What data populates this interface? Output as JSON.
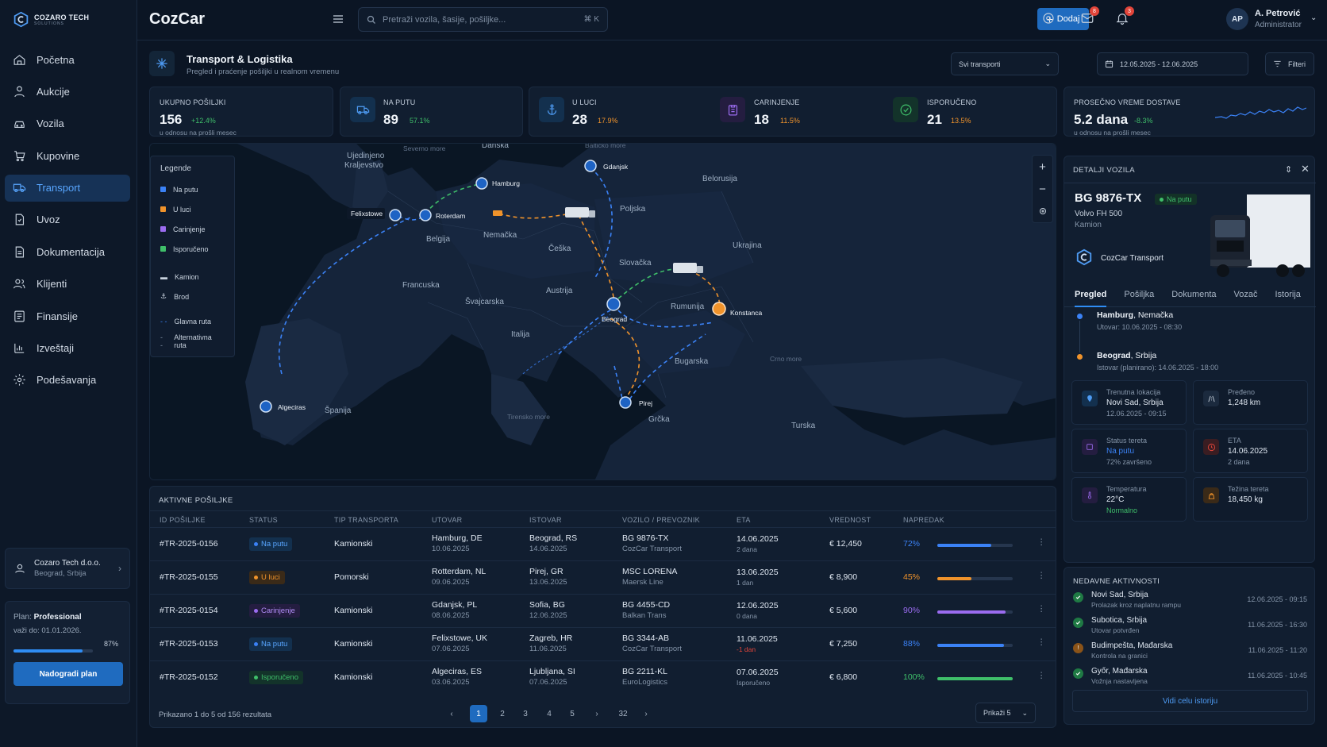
{
  "brand": {
    "name": "COZARO TECH",
    "sub": "SOLUTIONS"
  },
  "app_title": "CozCar",
  "nav": [
    {
      "label": "Početna",
      "icon": "home-icon"
    },
    {
      "label": "Aukcije",
      "icon": "gavel-icon"
    },
    {
      "label": "Vozila",
      "icon": "car-icon"
    },
    {
      "label": "Kupovine",
      "icon": "cart-icon"
    },
    {
      "label": "Transport",
      "icon": "truck-icon",
      "active": true
    },
    {
      "label": "Uvoz",
      "icon": "import-icon"
    },
    {
      "label": "Dokumentacija",
      "icon": "document-icon"
    },
    {
      "label": "Klijenti",
      "icon": "users-icon"
    },
    {
      "label": "Finansije",
      "icon": "finance-icon"
    },
    {
      "label": "Izveštaji",
      "icon": "report-icon"
    },
    {
      "label": "Podešavanja",
      "icon": "gear-icon"
    }
  ],
  "company": {
    "name": "Cozaro Tech d.o.o.",
    "city": "Beograd, Srbija"
  },
  "plan": {
    "label": "Plan:",
    "name": "Professional",
    "valid": "važi do: 01.01.2026.",
    "usage": 0.87,
    "usage_text": "87%",
    "button": "Nadogradi plan"
  },
  "search": {
    "placeholder": "Pretraži vozila, šasije, pošiljke...",
    "shortcut": "⌘ K"
  },
  "add_button": "Dodaj",
  "notifications": {
    "mail": "8",
    "bell": "3"
  },
  "user": {
    "initials": "AP",
    "name": "A. Petrović",
    "role": "Administrator"
  },
  "page": {
    "title": "Transport & Logistika",
    "subtitle": "Pregled i praćenje pošiljki u realnom vremenu"
  },
  "filters": {
    "transport": "Svi transporti",
    "dates": "12.05.2025 - 12.06.2025",
    "filter": "Filteri"
  },
  "kpis": [
    {
      "label": "UKUPNO POŠILJKI",
      "value": "156",
      "pct": "+12.4%",
      "note": "u odnosu na prošli mesec",
      "color": "#3fbf6a"
    },
    {
      "label": "NA PUTU",
      "value": "89",
      "pct": "57.1%",
      "color": "#3fbf6a"
    },
    {
      "label": "U LUCI",
      "value": "28",
      "pct": "17.9%",
      "color": "#f0932b"
    },
    {
      "label": "CARINJENJE",
      "value": "18",
      "pct": "11.5%",
      "color": "#f0932b"
    },
    {
      "label": "ISPORUČENO",
      "value": "21",
      "pct": "13.5%",
      "color": "#f0932b"
    },
    {
      "label": "PROSEČNO VREME DOSTAVE",
      "value": "5.2 dana",
      "pct": "-8.3%",
      "note": "u odnosu na prošli mesec",
      "color": "#3fbf6a"
    }
  ],
  "legend": {
    "title": "Legende",
    "items": [
      "Na putu",
      "U luci",
      "Carinjenje",
      "Isporučeno",
      "Kamion",
      "Brod",
      "Glavna ruta",
      "Alternativna ruta"
    ],
    "colors": [
      "#3b82f6",
      "#f0932b",
      "#9b6cf0",
      "#3fbf6a"
    ]
  },
  "map": {
    "countries": [
      "Ujedinjeno Kraljevstvo",
      "Danska",
      "Belorusija",
      "Poljska",
      "Nemačka",
      "Belgija",
      "Češka",
      "Slovačka",
      "Ukrajina",
      "Francuska",
      "Švajcarska",
      "Austrija",
      "Rumunija",
      "Italija",
      "Bugarska",
      "Španija",
      "Grčka",
      "Turska"
    ],
    "seas": [
      "Severno more",
      "Baltičko more",
      "Crno more",
      "Tirensko more"
    ],
    "ports": [
      "Felixstowe",
      "Roterdam",
      "Hamburg",
      "Gdanjsk",
      "Beograd",
      "Konstanca",
      "Pirej",
      "Algeciras"
    ]
  },
  "detail": {
    "header": "DETALJI VOZILA",
    "plate": "BG 9876-TX",
    "status": "Na putu",
    "model": "Volvo FH 500",
    "type": "Kamion",
    "carrier": "CozCar Transport",
    "tabs": [
      "Pregled",
      "Pošiljka",
      "Dokumenta",
      "Vozač",
      "Istorija"
    ],
    "from": {
      "city": "Hamburg",
      "country": ", Nemačka",
      "time": "Utovar: 10.06.2025 - 08:30"
    },
    "to": {
      "city": "Beograd",
      "country": ", Srbija",
      "time": "Istovar (planirano): 14.06.2025 - 18:00"
    },
    "tiles": [
      {
        "l": "Trenutna lokacija",
        "v": "Novi Sad, Srbija",
        "s": "12.06.2025 - 09:15"
      },
      {
        "l": "Pređeno",
        "v": "1,248 km",
        "s": ""
      },
      {
        "l": "Status tereta",
        "v": "Na putu",
        "s": "72% završeno"
      },
      {
        "l": "ETA",
        "v": "14.06.2025",
        "s": "2 dana"
      },
      {
        "l": "Temperatura",
        "v": "22°C",
        "s": "Normalno"
      },
      {
        "l": "Težina tereta",
        "v": "18,450 kg",
        "s": ""
      }
    ]
  },
  "activities": {
    "title": "NEDAVNE AKTIVNOSTI",
    "items": [
      {
        "name": "Novi Sad, Srbija",
        "desc": "Prolazak kroz naplatnu rampu",
        "time": "12.06.2025 - 09:15"
      },
      {
        "name": "Subotica, Srbija",
        "desc": "Utovar potvrđen",
        "time": "11.06.2025 - 16:30"
      },
      {
        "name": "Budimpešta, Mađarska",
        "desc": "Kontrola na granici",
        "time": "11.06.2025 - 11:20"
      },
      {
        "name": "Győr, Mađarska",
        "desc": "Vožnja nastavljena",
        "time": "11.06.2025 - 10:45"
      }
    ],
    "button": "Vidi celu istoriju"
  },
  "table": {
    "title": "AKTIVNE POŠILJKE",
    "headers": [
      "ID POŠILJKE",
      "STATUS",
      "TIP TRANSPORTA",
      "UTOVAR",
      "ISTOVAR",
      "VOZILO / PREVOZNIK",
      "ETA",
      "VREDNOST",
      "NAPREDAK"
    ],
    "rows": [
      {
        "id": "#TR-2025-0156",
        "status": "Na putu",
        "type": "Kamionski",
        "from": "Hamburg, DE",
        "from_d": "10.06.2025",
        "to": "Beograd, RS",
        "to_d": "14.06.2025",
        "veh": "BG 9876-TX",
        "car": "CozCar Transport",
        "eta": "14.06.2025",
        "eta_s": "2 dana",
        "val": "€ 12,450",
        "prog": 0.72,
        "prog_t": "72%"
      },
      {
        "id": "#TR-2025-0155",
        "status": "U luci",
        "type": "Pomorski",
        "from": "Rotterdam, NL",
        "from_d": "09.06.2025",
        "to": "Pirej, GR",
        "to_d": "13.06.2025",
        "veh": "MSC LORENA",
        "car": "Maersk Line",
        "eta": "13.06.2025",
        "eta_s": "1 dan",
        "val": "€ 8,900",
        "prog": 0.45,
        "prog_t": "45%"
      },
      {
        "id": "#TR-2025-0154",
        "status": "Carinjenje",
        "type": "Kamionski",
        "from": "Gdanjsk, PL",
        "from_d": "08.06.2025",
        "to": "Sofia, BG",
        "to_d": "12.06.2025",
        "veh": "BG 4455-CD",
        "car": "Balkan Trans",
        "eta": "12.06.2025",
        "eta_s": "0 dana",
        "val": "€ 5,600",
        "prog": 0.9,
        "prog_t": "90%"
      },
      {
        "id": "#TR-2025-0153",
        "status": "Na putu",
        "type": "Kamionski",
        "from": "Felixstowe, UK",
        "from_d": "07.06.2025",
        "to": "Zagreb, HR",
        "to_d": "11.06.2025",
        "veh": "BG 3344-AB",
        "car": "CozCar Transport",
        "eta": "11.06.2025",
        "eta_s": "-1 dan",
        "val": "€ 7,250",
        "prog": 0.88,
        "prog_t": "88%"
      },
      {
        "id": "#TR-2025-0152",
        "status": "Isporučeno",
        "type": "Kamionski",
        "from": "Algeciras, ES",
        "from_d": "03.06.2025",
        "to": "Ljubljana, SI",
        "to_d": "07.06.2025",
        "veh": "BG 2211-KL",
        "car": "EuroLogistics",
        "eta": "07.06.2025",
        "eta_s": "Isporučeno",
        "val": "€ 6,800",
        "prog": 1.0,
        "prog_t": "100%"
      }
    ],
    "footer": "Prikazano 1 do 5 od 156 rezultata",
    "pages": [
      "1",
      "2",
      "3",
      "4",
      "5",
      "32"
    ],
    "per_page": "Prikaži 5"
  }
}
